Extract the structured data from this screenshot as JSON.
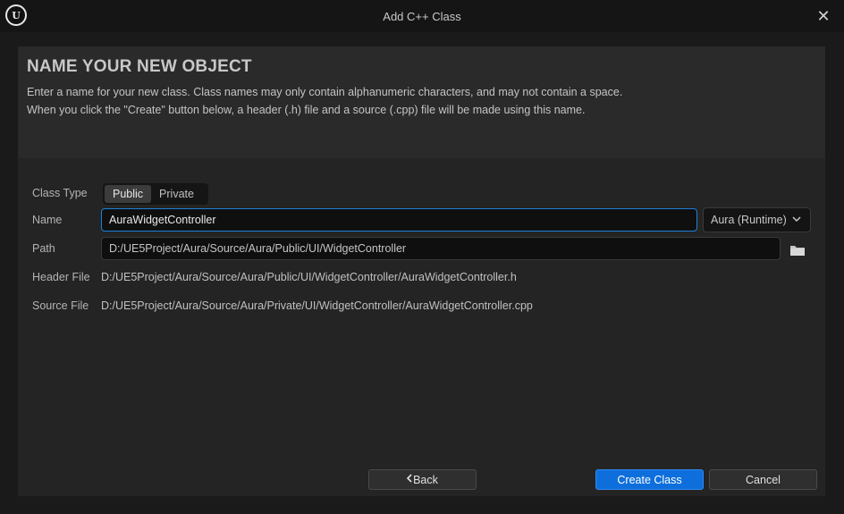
{
  "window": {
    "title": "Add C++ Class",
    "logo_letter": "U"
  },
  "header": {
    "heading": "NAME YOUR NEW OBJECT",
    "description_line1": "Enter a name for your new class. Class names may only contain alphanumeric characters, and may not contain a space.",
    "description_line2": "When you click the \"Create\" button below, a header (.h) file and a source (.cpp) file will be made using this name."
  },
  "form": {
    "class_type_label": "Class Type",
    "class_type_options": [
      "Public",
      "Private"
    ],
    "class_type_selected": "Public",
    "name_label": "Name",
    "name_value": "AuraWidgetController",
    "module_selected": "Aura (Runtime)",
    "path_label": "Path",
    "path_value": "D:/UE5Project/Aura/Source/Aura/Public/UI/WidgetController",
    "header_file_label": "Header File",
    "header_file_value": "D:/UE5Project/Aura/Source/Aura/Public/UI/WidgetController/AuraWidgetController.h",
    "source_file_label": "Source File",
    "source_file_value": "D:/UE5Project/Aura/Source/Aura/Private/UI/WidgetController/AuraWidgetController.cpp"
  },
  "buttons": {
    "back": "Back",
    "create": "Create Class",
    "cancel": "Cancel"
  },
  "colors": {
    "accent": "#0e6fdc",
    "focus_border": "#1f7fd8",
    "background": "#242424"
  }
}
